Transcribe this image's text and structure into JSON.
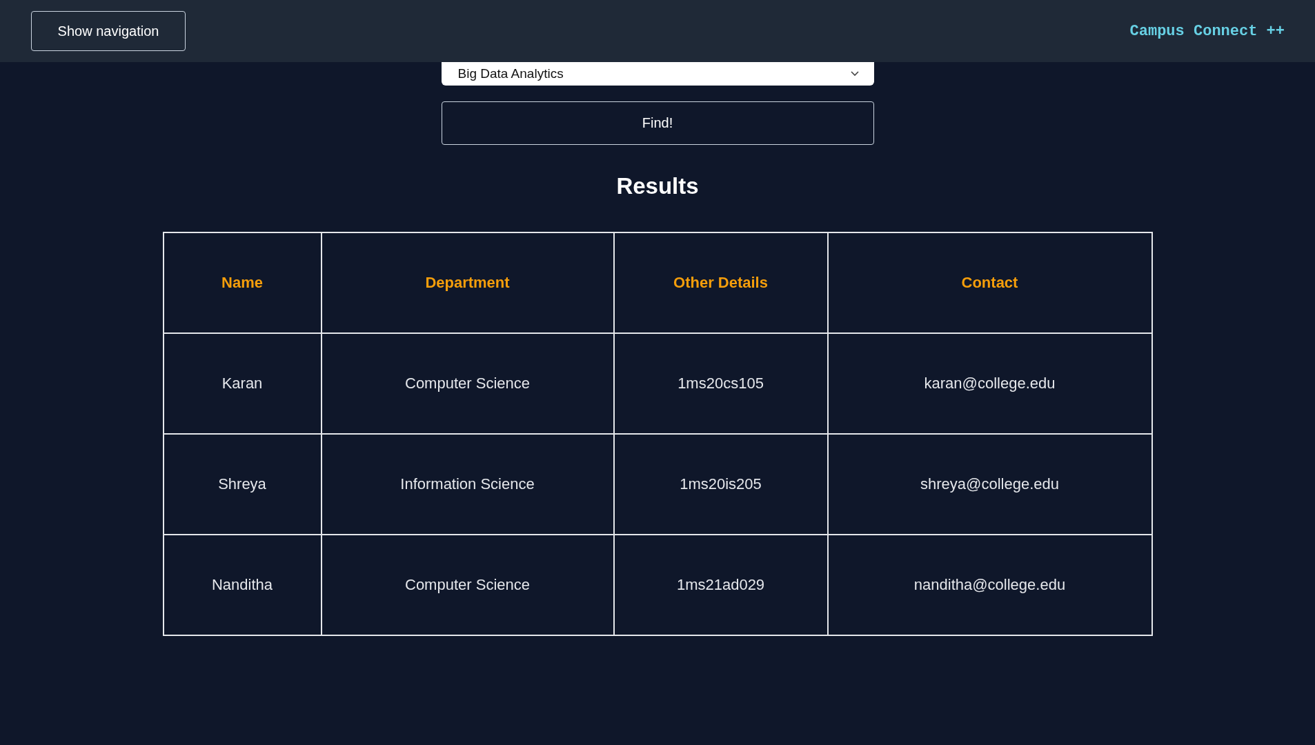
{
  "header": {
    "nav_button": "Show navigation",
    "brand": "Campus Connect ++"
  },
  "search": {
    "select_value": "Big Data Analytics",
    "find_button": "Find!"
  },
  "results": {
    "title": "Results",
    "columns": [
      "Name",
      "Department",
      "Other Details",
      "Contact"
    ],
    "rows": [
      {
        "cells": [
          "Karan",
          "Computer Science",
          "1ms20cs105",
          "karan@college.edu"
        ]
      },
      {
        "cells": [
          "Shreya",
          "Information Science",
          "1ms20is205",
          "shreya@college.edu"
        ]
      },
      {
        "cells": [
          "Nanditha",
          "Computer Science",
          "1ms21ad029",
          "nanditha@college.edu"
        ]
      }
    ]
  }
}
